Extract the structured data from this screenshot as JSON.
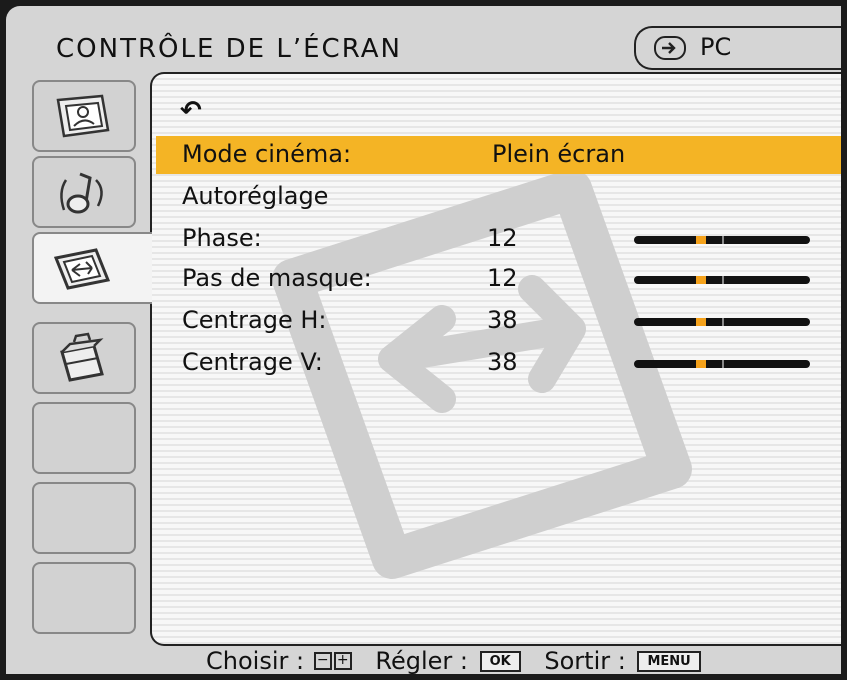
{
  "header": {
    "title": "CONTRÔLE DE L’ÉCRAN",
    "source_icon": "input-source-icon",
    "source_label": "PC"
  },
  "tabs": [
    {
      "icon": "picture-icon",
      "active": false
    },
    {
      "icon": "sound-icon",
      "active": false
    },
    {
      "icon": "screen-adjust-icon",
      "active": true
    },
    {
      "icon": "setup-icon",
      "active": false
    },
    {
      "icon": "",
      "active": false
    },
    {
      "icon": "",
      "active": false
    },
    {
      "icon": "",
      "active": false
    }
  ],
  "menu": {
    "back_icon": "↶",
    "items": [
      {
        "label": "Mode cinéma:",
        "value": "Plein écran"
      },
      {
        "label": "Autoréglage",
        "value": ""
      },
      {
        "label": "Phase:",
        "value": "12",
        "level": 0.38
      },
      {
        "label": "Pas de masque:",
        "value": "12",
        "level": 0.38
      },
      {
        "label": "Centrage H:",
        "value": "38",
        "level": 0.38
      },
      {
        "label": "Centrage V:",
        "value": "38",
        "level": 0.38
      }
    ]
  },
  "footer": {
    "choose_label": "Choisir :",
    "minus": "−",
    "plus": "+",
    "adjust_label": "Régler :",
    "ok_key": "OK",
    "exit_label": "Sortir :",
    "menu_key": "MENU"
  },
  "colors": {
    "highlight": "#f4b425",
    "slider_thumb": "#f4a11a"
  }
}
